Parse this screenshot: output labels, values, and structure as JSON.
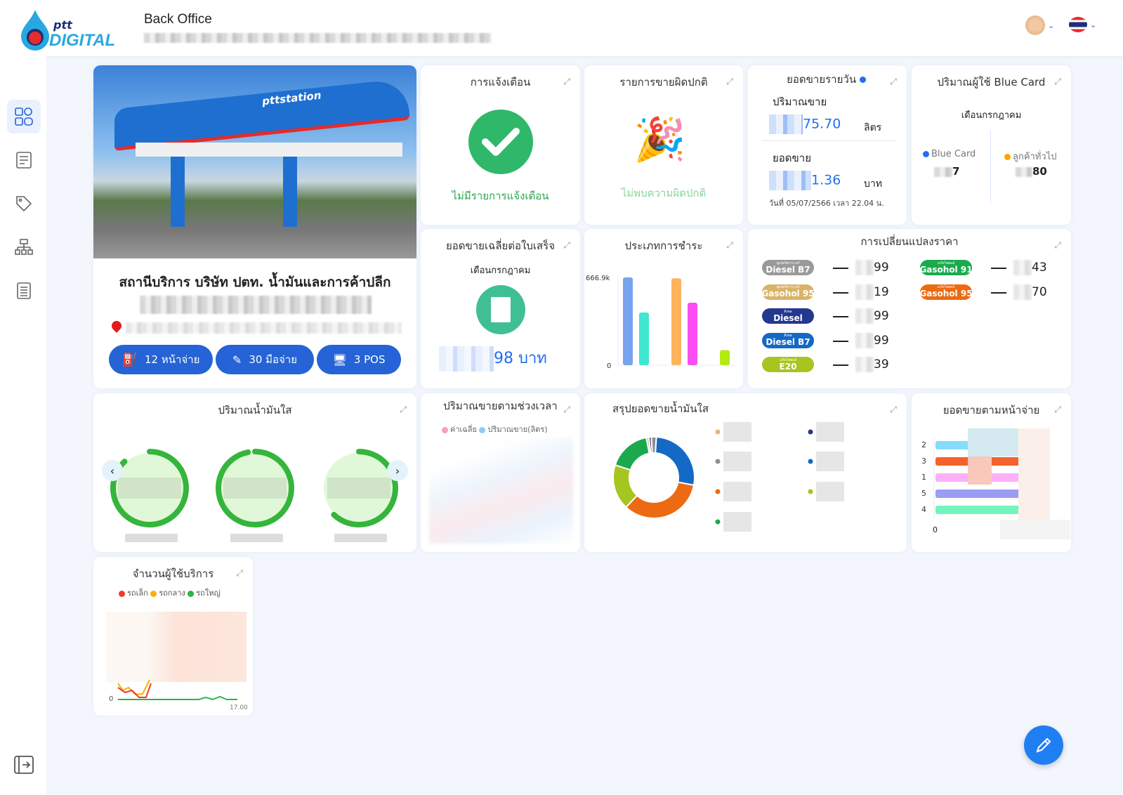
{
  "header": {
    "brand_top": "ptt",
    "brand_bottom": "DIGITAL",
    "title": "Back Office",
    "subtitle_blurred": true
  },
  "sidebar": {
    "items": [
      {
        "icon": "dashboard-icon",
        "active": true
      },
      {
        "icon": "list-check-icon"
      },
      {
        "icon": "tag-icon"
      },
      {
        "icon": "sitemap-icon"
      },
      {
        "icon": "document-list-icon"
      }
    ],
    "logout_icon": "logout-icon"
  },
  "station": {
    "name": "สถานีบริการ บริษัท ปตท. น้ำมันและการค้าปลีก",
    "photo_label": "pttstation",
    "buttons": [
      {
        "label": "12 หน้าจ่าย",
        "icon": "fuel-pump-icon"
      },
      {
        "label": "30 มือจ่าย",
        "icon": "fuel-nozzle-icon"
      },
      {
        "label": "3 POS",
        "icon": "pos-terminal-icon"
      }
    ]
  },
  "alerts": {
    "title": "การแจ้งเตือน",
    "message": "ไม่มีรายการแจ้งเตือน"
  },
  "abnormal": {
    "title": "รายการขายผิดปกติ",
    "message": "ไม่พบความผิดปกติ"
  },
  "daily": {
    "title": "ยอดขายรายวัน",
    "volume_label": "ปริมาณขาย",
    "volume_value": "75.70",
    "volume_unit": "ลิตร",
    "sales_label": "ยอดขาย",
    "sales_value": "1.36",
    "sales_unit": "บาท",
    "timestamp": "วันที่ 05/07/2566 เวลา 22.04 น.",
    "status_color": "#1f6ff2"
  },
  "bluecard": {
    "title": "ปริมาณผู้ใช้ Blue Card",
    "month": "เดือนกรกฎาคม",
    "items": [
      {
        "label": "Blue Card",
        "value": "7",
        "color": "#1f6ff2"
      },
      {
        "label": "ลูกค้าทั่วไป",
        "value": "80",
        "color": "#f7a600"
      }
    ]
  },
  "avg_receipt": {
    "title": "ยอดขายเฉลี่ยต่อใบเสร็จ",
    "month": "เดือนกรกฎาคม",
    "value": "98 บาท"
  },
  "payment": {
    "title": "ประเภทการชำระ"
  },
  "price": {
    "title": "การเปลี่ยนแปลงราคา",
    "items": [
      {
        "name": "Diesel B7",
        "sub": "ซูเปอร์พาวเวอร์",
        "value": "99",
        "bg": "#9a9a9a",
        "col": 0
      },
      {
        "name": "Gasohol 95",
        "sub": "ซูเปอร์พาวเวอร์",
        "value": "19",
        "bg": "#d9b36a",
        "col": 0
      },
      {
        "name": "Diesel",
        "sub": "ดีเซล",
        "value": "99",
        "bg": "#23388f",
        "col": 0
      },
      {
        "name": "Diesel B7",
        "sub": "ดีเซล",
        "value": "99",
        "bg": "#1469c7",
        "col": 0
      },
      {
        "name": "E20",
        "sub": "แก๊สโซฮอล์",
        "value": "39",
        "bg": "#a7c520",
        "col": 0
      },
      {
        "name": "Gasohol 91",
        "sub": "แก๊สโซฮอล์",
        "value": "43",
        "bg": "#1aaa4d",
        "col": 1
      },
      {
        "name": "Gasohol 95",
        "sub": "แก๊สโซฮอล์",
        "value": "70",
        "bg": "#ec6a12",
        "col": 1
      }
    ]
  },
  "tank": {
    "title": "ปริมาณน้ำมันใส",
    "gauges": [
      0.88,
      0.97,
      0.62
    ]
  },
  "timeseries": {
    "title": "ปริมาณขายตามช่วงเวลา",
    "legend": [
      {
        "label": "ค่าเฉลี่ย",
        "color": "#f7a1b3"
      },
      {
        "label": "ปริมาณขาย(ลิตร)",
        "color": "#8ccbf7"
      }
    ]
  },
  "summary": {
    "title": "สรุปยอดขายน้ำมันใส",
    "legend_colors": [
      "#e0b870",
      "#23388f",
      "#8f8f8f",
      "#1469c7",
      "#ec6a12",
      "#a7c520",
      "#1aaa4d"
    ]
  },
  "dispenser": {
    "title": "ยอดขายตามหน้าจ่าย",
    "zero": "0"
  },
  "customers": {
    "title": "จำนวนผู้ใช้บริการ",
    "legend": [
      {
        "label": "รถเล็ก",
        "color": "#f03a2e"
      },
      {
        "label": "รถกลาง",
        "color": "#f7b100"
      },
      {
        "label": "รถใหญ่",
        "color": "#2db34a"
      }
    ],
    "y0": "0",
    "xlabel": "17.00"
  },
  "chart_data": [
    {
      "type": "bar",
      "title": "ประเภทการชำระ",
      "ylim": [
        0,
        666.9
      ],
      "ytick_labels": [
        "0",
        "666.9k"
      ],
      "values": [
        666.9,
        400,
        660,
        475,
        115
      ],
      "colors": [
        "#77a3ef",
        "#3fe6d0",
        "#ffb35c",
        "#f94ef2",
        "#b3ea10"
      ],
      "unit": "k"
    },
    {
      "type": "pie",
      "title": "สรุปยอดขายน้ำมันใส",
      "values": [
        1,
        1,
        2,
        27,
        34,
        18,
        17
      ],
      "colors": [
        "#e0b870",
        "#23388f",
        "#8f8f8f",
        "#1469c7",
        "#ec6a12",
        "#a7c520",
        "#1aaa4d"
      ]
    },
    {
      "type": "bar",
      "title": "ยอดขายตามหน้าจ่าย",
      "orientation": "horizontal",
      "categories": [
        "2",
        "3",
        "1",
        "5",
        "4"
      ],
      "colors": [
        "#85dcfb",
        "#f5622b",
        "#fcb0f6",
        "#9b9cf5",
        "#72f5bd"
      ]
    }
  ]
}
